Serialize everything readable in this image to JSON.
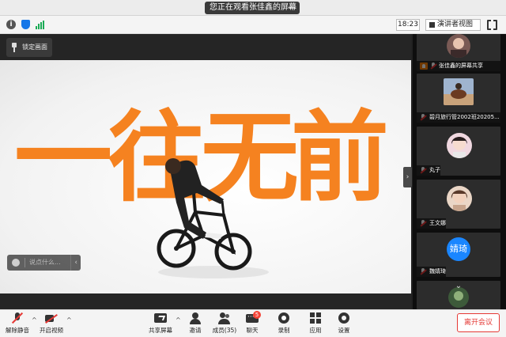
{
  "window": {
    "title": "您正在观看张佳鑫的屏幕",
    "minimize_label": "—"
  },
  "statusbar": {
    "info_icon_text": "i",
    "time": "18:23",
    "view_mode": "演讲者视图"
  },
  "share": {
    "pin_label": "锁定画面",
    "slogan": [
      "一",
      "往",
      "无",
      "前"
    ],
    "chat_placeholder": "说点什么...",
    "chat_collapse": "‹",
    "collapse_handle": "›"
  },
  "participants": [
    {
      "name": "张佳鑫的屏幕共享",
      "type": "screen-share",
      "avatar": "photo"
    },
    {
      "name": "碧月旅行管2002班20205...",
      "type": "participant",
      "avatar": "photo"
    },
    {
      "name": "丸子",
      "type": "participant",
      "avatar": "photo"
    },
    {
      "name": "王文娜",
      "type": "participant",
      "avatar": "photo"
    },
    {
      "name": "魏婧琦",
      "type": "participant",
      "avatar": "text",
      "avatar_text": "婧琦"
    },
    {
      "name": "",
      "type": "participant",
      "avatar": "photo"
    }
  ],
  "panel": {
    "scroll_down": "⌄"
  },
  "toolbar": {
    "unmute": "解除静音",
    "start_video": "开启视频",
    "share_screen": "共享屏幕",
    "invite": "邀请",
    "members": "成员(35)",
    "chat": "聊天",
    "chat_badge": "5",
    "record": "录制",
    "apps": "应用",
    "settings": "设置",
    "leave": "离开会议",
    "caret": "^"
  },
  "colors": {
    "brand_orange": "#f58220",
    "leave_red": "#e53935",
    "avatar_blue": "#1a86ff"
  }
}
